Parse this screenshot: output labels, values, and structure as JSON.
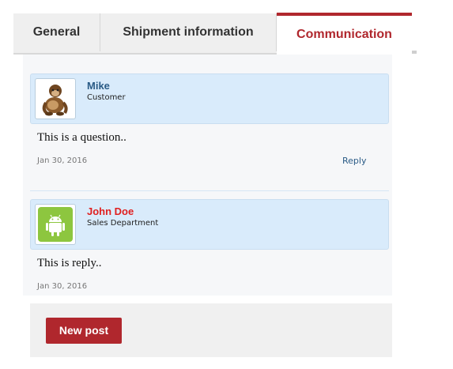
{
  "tabs": {
    "general": "General",
    "shipment": "Shipment information",
    "communication": "Communication",
    "active": "communication"
  },
  "messages": [
    {
      "author": "Mike",
      "role": "Customer",
      "text": "This is a question..",
      "date": "Jan 30, 2016",
      "reply_label": "Reply",
      "name_color": "#2a5b86",
      "avatar_icon": "monkey-avatar-icon"
    },
    {
      "author": "John Doe",
      "role": "Sales Department",
      "text": "This is reply..",
      "date": "Jan 30, 2016",
      "name_color": "#e02020",
      "avatar_icon": "android-icon"
    }
  ],
  "footer": {
    "new_post_label": "New post",
    "accent": "#b0272d"
  }
}
